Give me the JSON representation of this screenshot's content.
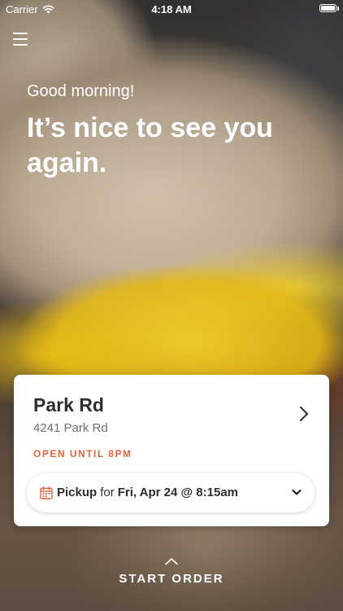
{
  "status_bar": {
    "carrier": "Carrier",
    "time": "4:18 AM"
  },
  "greeting": {
    "salutation": "Good morning!",
    "headline": "It’s nice to see you again."
  },
  "store": {
    "name": "Park Rd",
    "address": "4241 Park Rd",
    "hours": "OPEN UNTIL 8PM"
  },
  "order_mode": {
    "mode": "Pickup",
    "connector": "for",
    "time": "Fri, Apr 24 @ 8:15am"
  },
  "start_order": {
    "label": "START ORDER"
  },
  "colors": {
    "accent": "#e0643a",
    "text_dark": "#2d2d2d",
    "text_muted": "#6f6f6f"
  },
  "icons": [
    "wifi-icon",
    "battery-icon",
    "menu-icon",
    "chevron-right-icon",
    "calendar-icon",
    "chevron-down-icon",
    "chevron-up-icon"
  ]
}
